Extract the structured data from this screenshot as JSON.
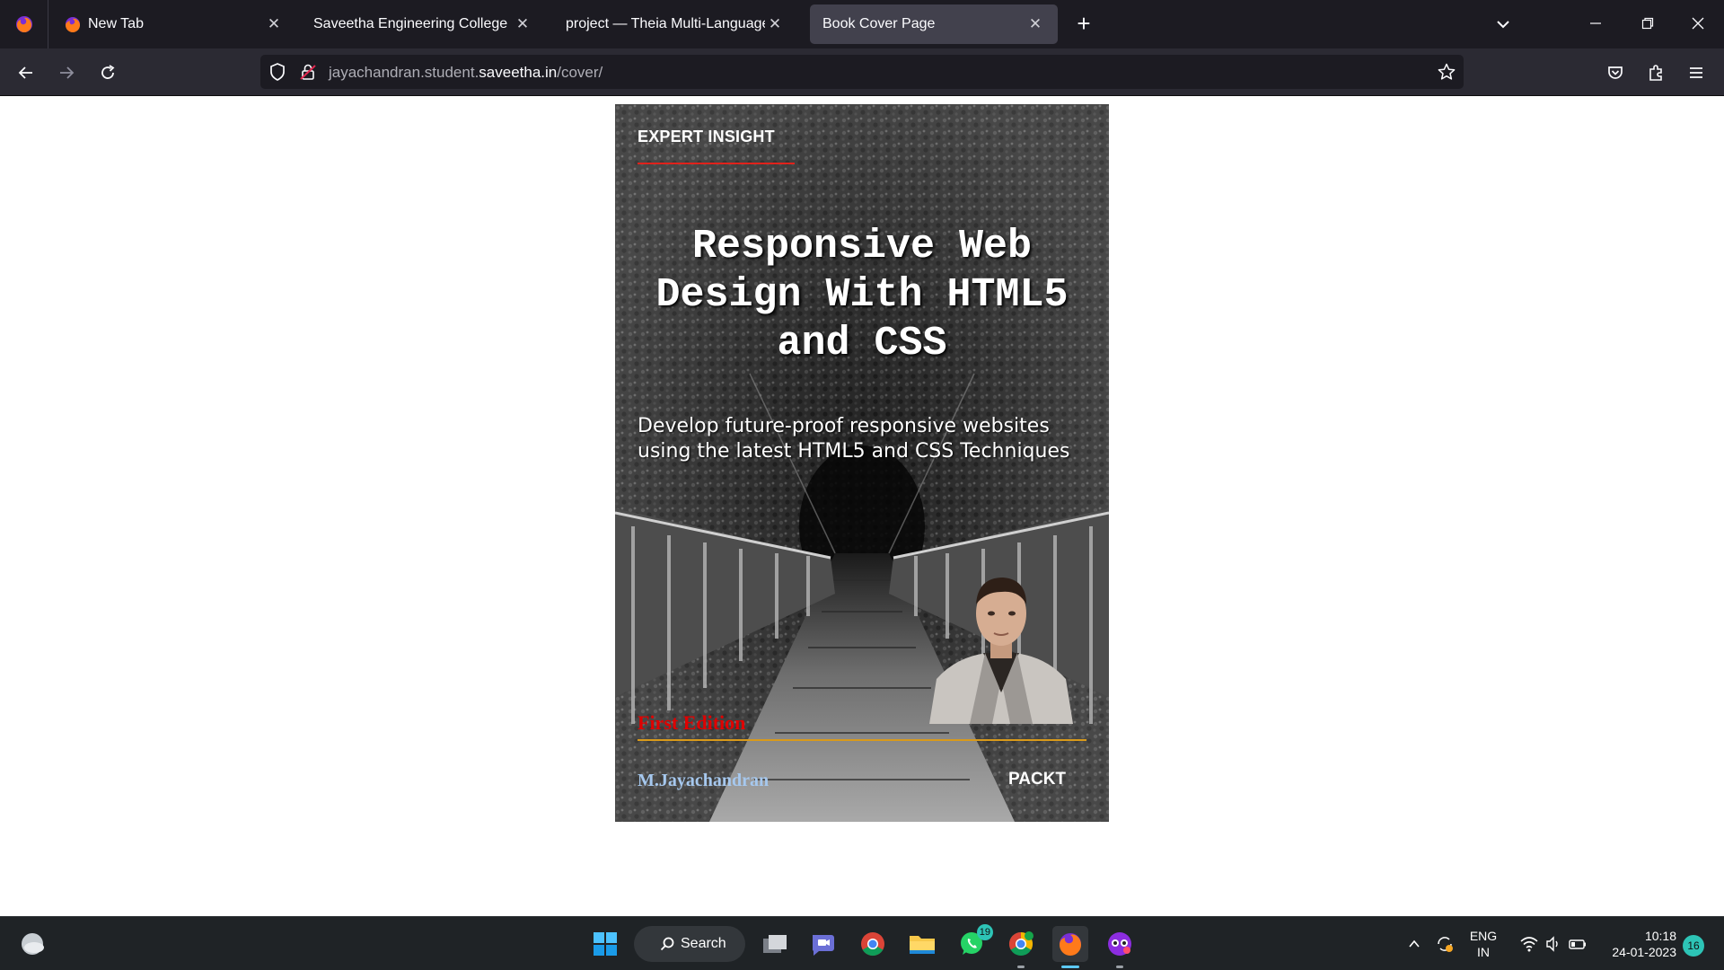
{
  "browser": {
    "tabs": [
      {
        "label": "New Tab",
        "active": false
      },
      {
        "label": "Saveetha Engineering College",
        "active": false
      },
      {
        "label": "project — Theia Multi-Language Ex",
        "active": false
      },
      {
        "label": "Book Cover Page",
        "active": true
      }
    ],
    "url": {
      "prefix": "jayachandran.student.",
      "domain": "saveetha.in",
      "path": "/cover/"
    }
  },
  "cover": {
    "series_label": "EXPERT INSIGHT",
    "title": "Responsive Web Design With HTML5 and CSS",
    "subtitle": "Develop future-proof responsive websites using the latest HTML5 and CSS Techniques",
    "edition": "First Edition",
    "author": "M.Jayachandran",
    "publisher": "PACKT",
    "colors": {
      "accent_red": "#e0221b",
      "edition_red": "#e00000",
      "rule_gold": "#d99a1a",
      "author_blue": "#a6c8ee"
    }
  },
  "taskbar": {
    "search_label": "Search",
    "whatsapp_badge": "19",
    "language": {
      "line1": "ENG",
      "line2": "IN"
    },
    "clock": {
      "time": "10:18",
      "date": "24-01-2023"
    },
    "notification_count": "16"
  }
}
